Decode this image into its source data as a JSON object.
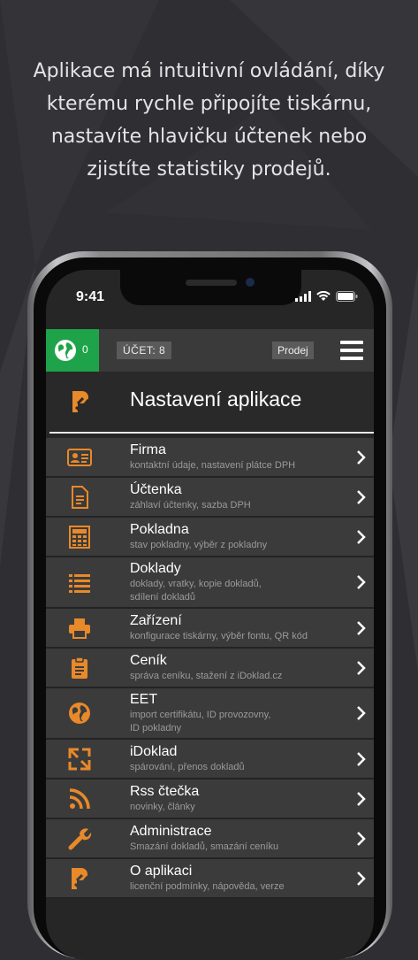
{
  "tagline": [
    "Aplikace má intuitivní ovládání, díky",
    "kterému rychle připojíte tiskárnu,",
    "nastavíte hlavičku účtenek nebo",
    "zjistíte statistiky prodejů."
  ],
  "status_bar": {
    "time": "9:41"
  },
  "topbar": {
    "globe_count": "0",
    "account_label": "ÚČET:  8",
    "prodej_label": "Prodej"
  },
  "header": {
    "title": "Nastavení aplikace"
  },
  "accent_color": "#e8892a",
  "menu": [
    {
      "icon": "id-card-icon",
      "title": "Firma",
      "subtitle": [
        "kontaktní údaje, nastavení plátce DPH"
      ]
    },
    {
      "icon": "document-icon",
      "title": "Účtenka",
      "subtitle": [
        "záhlaví účtenky, sazba DPH"
      ]
    },
    {
      "icon": "calculator-icon",
      "title": "Pokladna",
      "subtitle": [
        "stav pokladny, výběr z pokladny"
      ]
    },
    {
      "icon": "list-icon",
      "title": "Doklady",
      "subtitle": [
        "doklady, vratky, kopie dokladů,",
        "sdílení dokladů"
      ]
    },
    {
      "icon": "printer-icon",
      "title": "Zařízení",
      "subtitle": [
        "konfigurace tiskárny, výběr fontu, QR kód"
      ]
    },
    {
      "icon": "clipboard-icon",
      "title": "Ceník",
      "subtitle": [
        "správa ceníku, stažení z iDoklad.cz"
      ]
    },
    {
      "icon": "globe-icon",
      "title": "EET",
      "subtitle": [
        "import certifikátu, ID provozovny,",
        "ID pokladny"
      ]
    },
    {
      "icon": "sync-icon",
      "title": "iDoklad",
      "subtitle": [
        "spárování, přenos dokladů"
      ]
    },
    {
      "icon": "rss-icon",
      "title": "Rss čtečka",
      "subtitle": [
        "novinky, články"
      ]
    },
    {
      "icon": "wrench-icon",
      "title": "Administrace",
      "subtitle": [
        "Smazání dokladů, smazání ceníku"
      ]
    },
    {
      "icon": "app-logo-icon",
      "title": "O aplikaci",
      "subtitle": [
        "licenční podmínky, nápověda, verze"
      ]
    }
  ]
}
